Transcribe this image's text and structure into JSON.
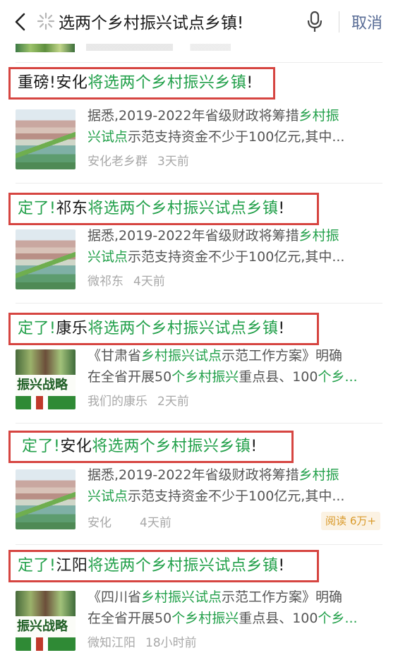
{
  "search": {
    "query": "选两个乡村振兴试点乡镇!",
    "cancel_label": "取消"
  },
  "results": [
    {
      "title_plain": "重磅!安化",
      "title_highlight": "将选两个乡村振兴乡镇",
      "title_tail": "!",
      "title_prefix_color": "plain",
      "snippet_line1_a": "据悉,2019-2022年省级财政将筹措",
      "snippet_line1_hl": "乡村振",
      "snippet_line2_hl": "兴试点",
      "snippet_line2_b": "示范支持资金不少于100亿元,其中...",
      "source": "安化老乡群",
      "time": "3天前",
      "thumb": "town-aerial-thumbnail"
    },
    {
      "title_green_prefix": "定了!",
      "title_plain": "祁东",
      "title_highlight": "将选两个乡村振兴试点乡镇",
      "title_tail": "!",
      "snippet_line1_a": "据悉,2019-2022年省级财政将筹措",
      "snippet_line1_hl": "乡村振",
      "snippet_line2_hl": "兴试点",
      "snippet_line2_b": "示范支持资金不少于100亿元,其中...",
      "source": "微祁东",
      "time": "4天前",
      "thumb": "town-aerial-thumbnail"
    },
    {
      "title_green_prefix": "定了!",
      "title_plain": "康乐",
      "title_highlight": "将选两个乡村振兴试点乡镇",
      "title_tail": "!",
      "snippet_line1_a": "《甘肃省",
      "snippet_line1_hl": "乡村振兴试点",
      "snippet_line1_b": "示范工作方案》明确",
      "snippet_line2_a": "在全省开展50",
      "snippet_line2_hl": "个乡村振兴",
      "snippet_line2_b": "重点县、100",
      "snippet_line2_hl2": "个乡...",
      "source": "我们的康乐",
      "time": "2天前",
      "thumb": "rural-revitalization-poster",
      "poster_text": "振兴战略"
    },
    {
      "title_green_prefix": "定了!",
      "title_plain": "安化",
      "title_highlight": "将选两个乡村振兴乡镇",
      "title_tail": "!",
      "snippet_line1_a": "据悉,2019-2022年省级财政将筹措",
      "snippet_line1_hl": "乡村振",
      "snippet_line2_hl": "兴试点",
      "snippet_line2_b": "示范支持资金不少于100亿元,其中...",
      "source": "安化",
      "time": "4天前",
      "read_badge": "阅读 6万+",
      "thumb": "town-aerial-thumbnail"
    },
    {
      "title_green_prefix": "定了!",
      "title_plain": "江阳",
      "title_highlight": "将选两个乡村振兴试点乡镇",
      "title_tail": "!",
      "snippet_line1_a": "《四川省",
      "snippet_line1_hl": "乡村振兴试点",
      "snippet_line1_b": "示范工作方案》明确",
      "snippet_line2_a": "在全省开展50",
      "snippet_line2_hl": "个乡村振兴",
      "snippet_line2_b": "重点县、100",
      "snippet_line2_hl2": "个乡...",
      "source": "微知江阳",
      "time": "18小时前",
      "thumb": "rural-revitalization-poster",
      "poster_text": "振兴战略"
    }
  ],
  "colors": {
    "highlight_green": "#22a04a",
    "annotation_red": "#d64541",
    "cancel_blue": "#576b95",
    "badge_orange": "#d99a2b"
  },
  "icons": [
    "back-arrow-icon",
    "loading-spinner-icon",
    "microphone-icon"
  ]
}
